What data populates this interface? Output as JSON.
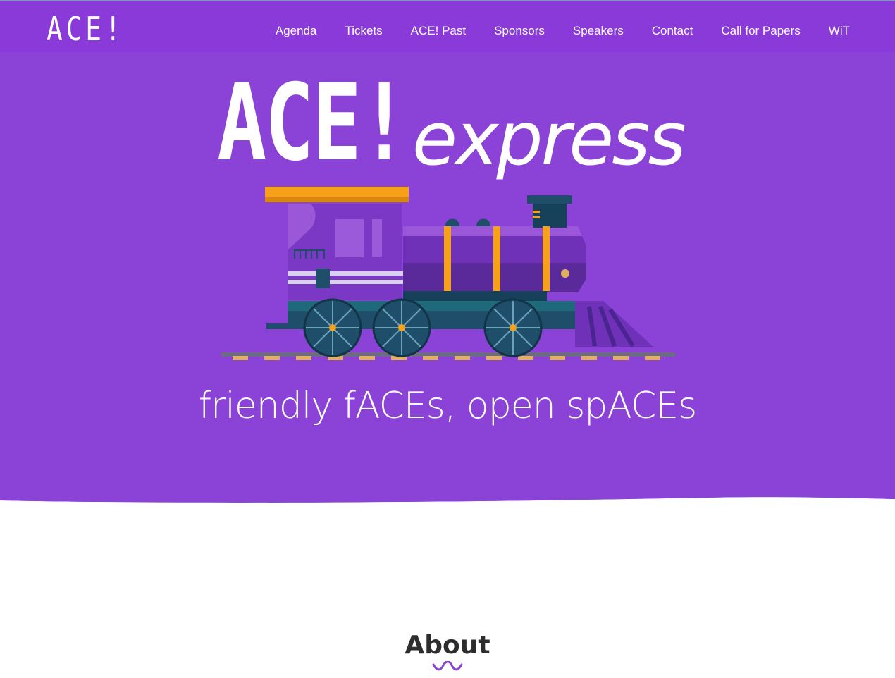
{
  "brand": {
    "logo_text": "ACE!"
  },
  "nav": {
    "items": [
      {
        "label": "Agenda"
      },
      {
        "label": "Tickets"
      },
      {
        "label": "ACE! Past"
      },
      {
        "label": "Sponsors"
      },
      {
        "label": "Speakers"
      },
      {
        "label": "Contact"
      },
      {
        "label": "Call for Papers"
      },
      {
        "label": "WiT"
      }
    ]
  },
  "hero": {
    "title_main": "ACE!",
    "title_sub": "express",
    "tagline": "friendly fACEs, open spACEs",
    "image": "train-locomotive-illustration"
  },
  "section": {
    "about_title": "About",
    "divider_icon": "squiggle-icon"
  },
  "colors": {
    "hero_bg": "#8a43d6",
    "nav_bg": "#8a3ad8",
    "accent_orange": "#f7a11a",
    "train_teal": "#1f4e6b",
    "text_dark": "#2d2d2d"
  }
}
